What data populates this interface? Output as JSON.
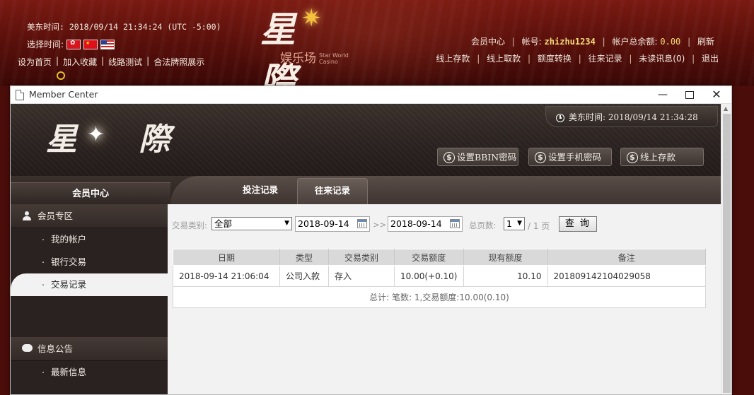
{
  "site": {
    "time_label": "美东时间:",
    "time_value": "2018/09/14 21:34:24 (UTC -5:00)",
    "lang_label": "选择时间:",
    "links": [
      "设为首页",
      "加入收藏",
      "线路测试",
      "合法牌照展示"
    ],
    "logo_chars": "星 際",
    "logo_sub": "娱乐场",
    "logo_sub_en1": "Star World",
    "logo_sub_en2": "Casino",
    "member_center": "会员中心",
    "account_label": "帐号:",
    "account": "zhizhu1234",
    "balance_label": "帐户总余额:",
    "balance": "0.00",
    "refresh": "刷新",
    "nav": [
      "线上存款",
      "线上取款",
      "额度转换",
      "往来记录"
    ],
    "unread": "未读讯息(0)",
    "logout": "退出"
  },
  "window": {
    "title": "Member Center",
    "min": "—",
    "close": "✕"
  },
  "member": {
    "logo_chars": "星 際",
    "time_label": "美东时间:",
    "time_value": "2018/09/14 21:34:28",
    "buttons": [
      "设置BBIN密码",
      "设置手机密码",
      "线上存款"
    ],
    "title": "会员中心",
    "tabs": [
      "投注记录",
      "往来记录"
    ]
  },
  "sidebar": {
    "section1": "会员专区",
    "items": [
      "我的帐户",
      "银行交易",
      "交易记录"
    ],
    "section2": "信息公告",
    "items2": [
      "最新信息"
    ]
  },
  "filter": {
    "type_label": "交易类别:",
    "type_value": "全部",
    "date_from": "2018-09-14",
    "range_sep": ">>",
    "date_to": "2018-09-14",
    "pages_label": "总页数:",
    "page_value": "1",
    "page_total": "/ 1 页",
    "query": "查 询"
  },
  "table": {
    "headers": [
      "日期",
      "类型",
      "交易类别",
      "交易额度",
      "现有额度",
      "备注"
    ],
    "rows": [
      [
        "2018-09-14 21:06:04",
        "公司入款",
        "存入",
        "10.00(+0.10)",
        "10.10",
        "201809142104029058"
      ]
    ],
    "total": "总计: 笔数: 1,交易额度:10.00(0.10)"
  },
  "colors": {
    "accent_gold": "#f4d97a",
    "header_red": "#5c100b",
    "panel_dark": "#2a2220"
  }
}
